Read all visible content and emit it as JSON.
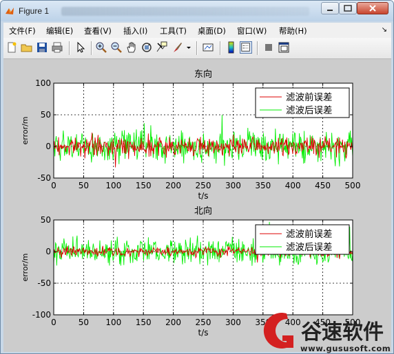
{
  "window": {
    "title": "Figure 1",
    "title_path_blurred": "Users › Administrator › Desktop › Matlab..."
  },
  "menu": [
    "文件(F)",
    "编辑(E)",
    "查看(V)",
    "插入(I)",
    "工具(T)",
    "桌面(D)",
    "窗口(W)",
    "帮助(H)"
  ],
  "toolbar": [
    "new-figure-icon",
    "open-folder-icon",
    "save-icon",
    "print-icon",
    "pointer-icon",
    "zoom-in-icon",
    "zoom-out-icon",
    "pan-hand-icon",
    "rotate-3d-icon",
    "data-cursor-icon",
    "brush-icon",
    "brush-dropdown-icon",
    "link-plot-icon",
    "colorbar-icon",
    "legend-icon",
    "hide-plot-tools-icon",
    "show-plot-tools-icon"
  ],
  "colors": {
    "before": "#dd0000",
    "after": "#00ee00",
    "axes_bg": "#ffffff",
    "figure_bg": "#cccccc"
  },
  "chart_data": [
    {
      "type": "line",
      "title": "东向",
      "xlabel": "t/s",
      "ylabel": "error/m",
      "xlim": [
        0,
        500
      ],
      "ylim": [
        -50,
        100
      ],
      "xticks": [
        0,
        50,
        100,
        150,
        200,
        250,
        300,
        350,
        400,
        450,
        500
      ],
      "yticks": [
        -50,
        0,
        50,
        100
      ],
      "grid": true,
      "legend_position": "top-right",
      "series": [
        {
          "name": "滤波前误差",
          "color": "#dd0000",
          "approx_amplitude": 15,
          "values": "500 noisy samples around 0, mostly within ±15 m, peaks ~±30 m"
        },
        {
          "name": "滤波后误差",
          "color": "#00ee00",
          "approx_amplitude": 30,
          "values": "500 noisy samples around 0, mostly within ±30 m, peaks ~+50 / -45 m"
        }
      ]
    },
    {
      "type": "line",
      "title": "北向",
      "xlabel": "t/s",
      "ylabel": "error/m",
      "xlim": [
        0,
        500
      ],
      "ylim": [
        -100,
        50
      ],
      "xticks": [
        0,
        50,
        100,
        150,
        200,
        250,
        300,
        350,
        400,
        450,
        500
      ],
      "yticks": [
        -100,
        -50,
        0,
        50
      ],
      "grid": true,
      "legend_position": "top-right",
      "series": [
        {
          "name": "滤波前误差",
          "color": "#dd0000",
          "approx_amplitude": 8,
          "values": "500 noisy samples around 0, mostly within ±10 m"
        },
        {
          "name": "滤波后误差",
          "color": "#00ee00",
          "approx_amplitude": 22,
          "values": "500 noisy samples around 0, mostly within ±25 m, peaks ~+40 / -45 m"
        }
      ]
    }
  ],
  "watermark": {
    "brand": "谷速软件",
    "url": "www.gususoft.com"
  }
}
